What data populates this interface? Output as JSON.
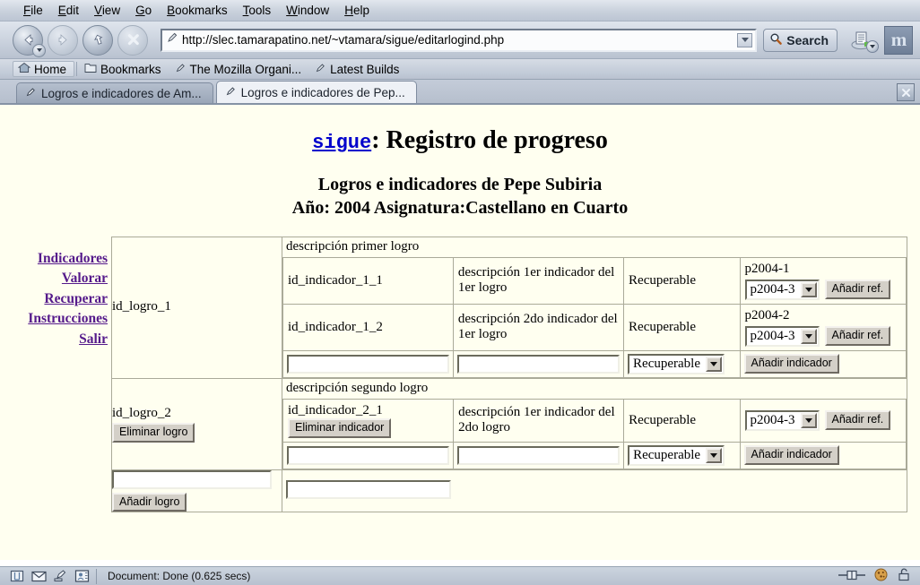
{
  "browser": {
    "menus": [
      "File",
      "Edit",
      "View",
      "Go",
      "Bookmarks",
      "Tools",
      "Window",
      "Help"
    ],
    "url": "http://slec.tamarapatino.net/~vtamara/sigue/editarlogind.php",
    "search_label": "Search",
    "mozilla_logo_text": "m",
    "bookmarks": [
      "Home",
      "Bookmarks",
      "The Mozilla Organi...",
      "Latest Builds"
    ],
    "tabs": [
      {
        "label": "Logros e indicadores de Am...",
        "active": false
      },
      {
        "label": "Logros e indicadores de Pep...",
        "active": true
      }
    ],
    "status_text": "Document: Done (0.625 secs)"
  },
  "page": {
    "brand_link": "sigue",
    "title_rest": ": Registro de progreso",
    "subtitle_line1": "Logros e indicadores de Pepe Subiria",
    "subtitle_line2": "Año: 2004 Asignatura:Castellano en Cuarto",
    "sidenav": [
      "Indicadores",
      "Valorar",
      "Recuperar",
      "Instrucciones",
      "Salir"
    ],
    "labels": {
      "add_ref": "Añadir ref.",
      "add_indicator": "Añadir indicador",
      "add_logro": "Añadir logro",
      "delete_logro": "Eliminar logro",
      "delete_indicator": "Eliminar indicador",
      "recuperable_option": "Recuperable",
      "ref_option": "p2004-3",
      "new_text_value": ""
    },
    "logros": [
      {
        "id": "id_logro_1",
        "description": "descripción primer logro",
        "has_delete": false,
        "indicators": [
          {
            "id": "id_indicador_1_1",
            "has_delete": false,
            "description": "descripción 1er indicador del 1er logro",
            "recuperable": "Recuperable",
            "ref_label": "p2004-1",
            "ref_select": "p2004-3"
          },
          {
            "id": "id_indicador_1_2",
            "has_delete": false,
            "description": "descripción 2do indicador del 1er logro",
            "recuperable": "Recuperable",
            "ref_label": "p2004-2",
            "ref_select": "p2004-3"
          }
        ]
      },
      {
        "id": "id_logro_2",
        "description": "descripción segundo logro",
        "has_delete": true,
        "indicators": [
          {
            "id": "id_indicador_2_1",
            "has_delete": true,
            "description": "descripción 1er indicador del 2do logro",
            "recuperable": "Recuperable",
            "ref_label": "",
            "ref_select": "p2004-3"
          }
        ]
      }
    ]
  }
}
